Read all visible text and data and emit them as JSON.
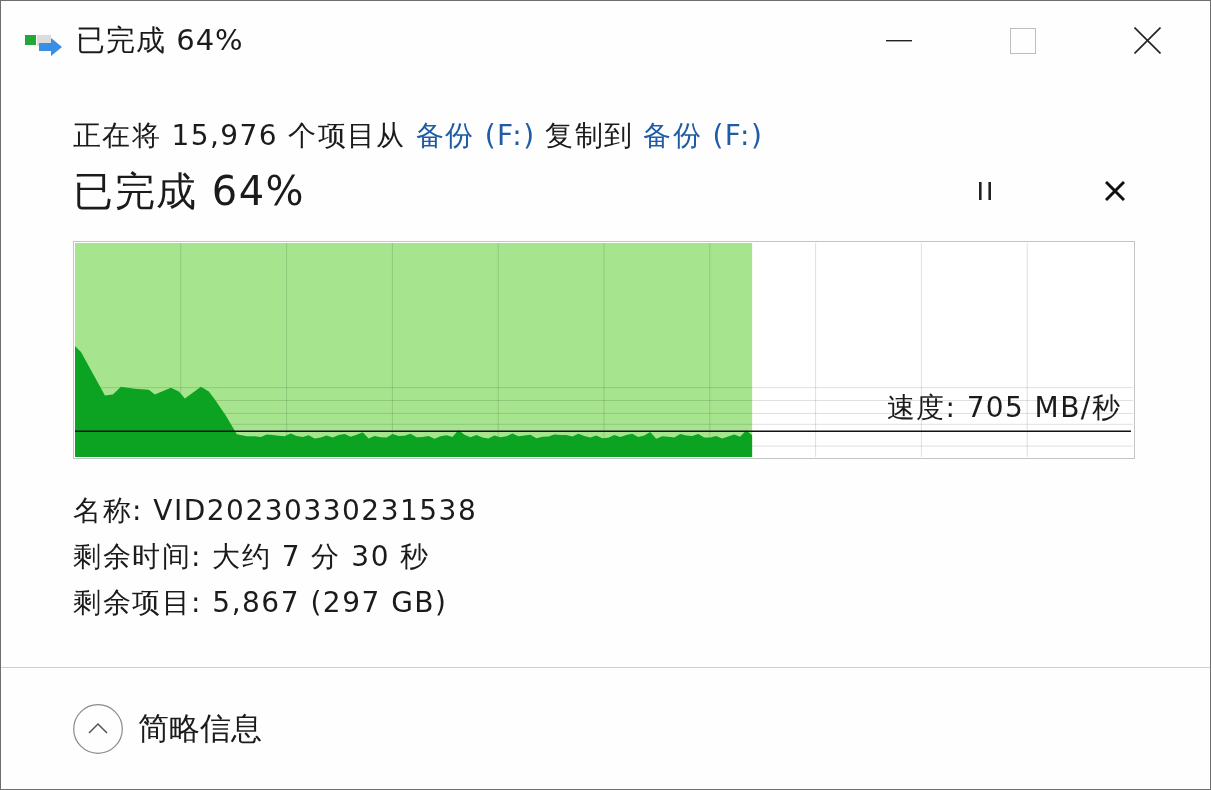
{
  "window": {
    "title": "已完成 64%"
  },
  "status": {
    "copy_line": [
      {
        "kind": "text",
        "text": "正在将 15,976 个项目从"
      },
      {
        "kind": "link",
        "text": "备份 (F:)"
      },
      {
        "kind": "text",
        "text": "复制到"
      },
      {
        "kind": "link",
        "text": "备份 (F:)"
      }
    ],
    "heading": "已完成 64%"
  },
  "graph": {
    "level": 0.64,
    "speed_label": "速度: 705 MB/秒"
  },
  "details": [
    "名称: VID20230330231538",
    "剩余时间: 大约 7 分 30 秒",
    "剩余项目: 5,867 (297 GB)"
  ],
  "footer": {
    "toggle_label": "简略信息",
    "expanded": true
  }
}
